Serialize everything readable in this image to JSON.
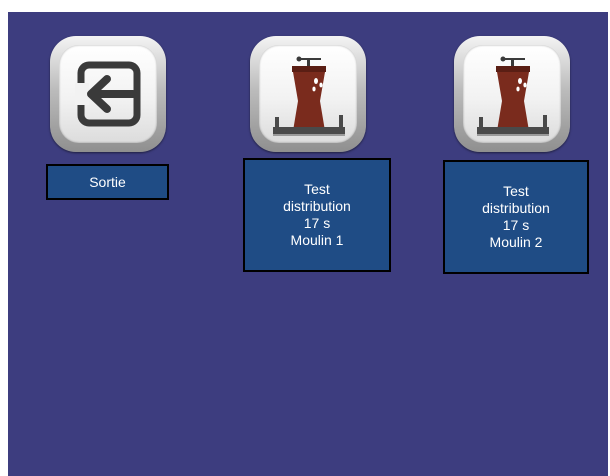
{
  "tiles": [
    {
      "icon": "exit-icon",
      "label": "Sortie"
    },
    {
      "icon": "coffee-grinder-icon",
      "label_lines": [
        "Test",
        "distribution",
        "17 s",
        "Moulin 1"
      ]
    },
    {
      "icon": "coffee-grinder-icon",
      "label_lines": [
        "Test",
        "distribution",
        "17 s",
        "Moulin 2"
      ]
    }
  ],
  "colors": {
    "background": "#3d3d7f",
    "label_fill": "#1f4c85",
    "grinder_body": "#7a2b1d"
  }
}
